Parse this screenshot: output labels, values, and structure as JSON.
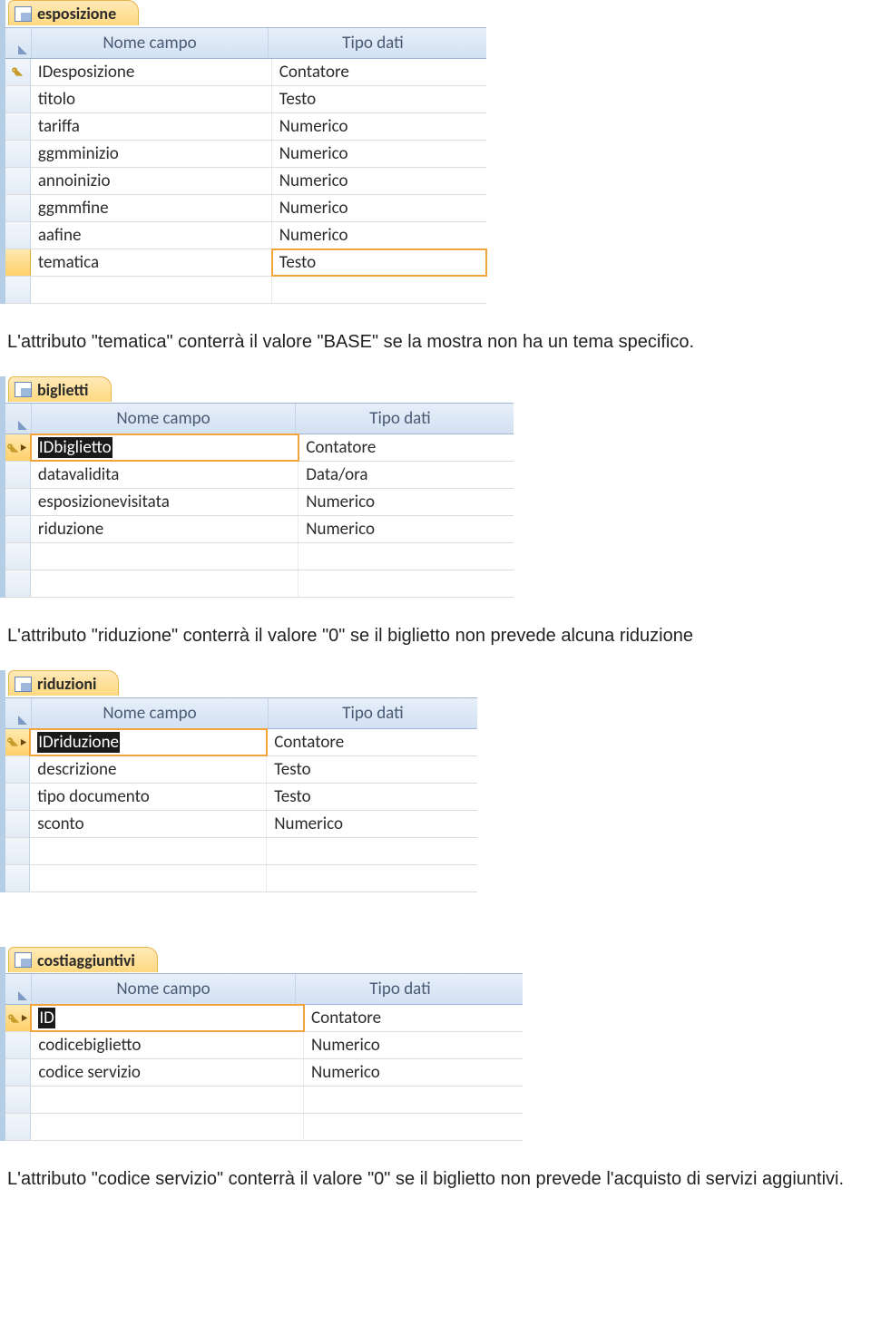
{
  "headers": {
    "nome_campo": "Nome campo",
    "tipo_dati": "Tipo dati"
  },
  "tables": {
    "esposizione": {
      "tab_label": "esposizione",
      "rows": [
        {
          "name": "IDesposizione",
          "type": "Contatore",
          "pk": true
        },
        {
          "name": "titolo",
          "type": "Testo"
        },
        {
          "name": "tariffa",
          "type": "Numerico"
        },
        {
          "name": "ggmminizio",
          "type": "Numerico"
        },
        {
          "name": "annoinizio",
          "type": "Numerico"
        },
        {
          "name": "ggmmfine",
          "type": "Numerico"
        },
        {
          "name": "aafine",
          "type": "Numerico"
        },
        {
          "name": "tematica",
          "type": "Testo"
        }
      ]
    },
    "biglietti": {
      "tab_label": "biglietti",
      "rows": [
        {
          "name": "IDbiglietto",
          "type": "Contatore",
          "pk": true,
          "selected": true
        },
        {
          "name": "datavalidita",
          "type": "Data/ora"
        },
        {
          "name": "esposizionevisitata",
          "type": "Numerico"
        },
        {
          "name": "riduzione",
          "type": "Numerico"
        }
      ]
    },
    "riduzioni": {
      "tab_label": "riduzioni",
      "rows": [
        {
          "name": "IDriduzione",
          "type": "Contatore",
          "pk": true,
          "selected": true
        },
        {
          "name": "descrizione",
          "type": "Testo"
        },
        {
          "name": "tipo documento",
          "type": "Testo"
        },
        {
          "name": "sconto",
          "type": "Numerico"
        }
      ]
    },
    "costiaggiuntivi": {
      "tab_label": "costiaggiuntivi",
      "rows": [
        {
          "name": "ID",
          "type": "Contatore",
          "pk": true,
          "selected": true
        },
        {
          "name": "codicebiglietto",
          "type": "Numerico"
        },
        {
          "name": "codice servizio",
          "type": "Numerico"
        }
      ]
    }
  },
  "paragraphs": {
    "p1": "L'attributo \"tematica\" conterrà il valore \"BASE\" se la mostra non ha un tema specifico.",
    "p2": "L'attributo \"riduzione\" conterrà il valore \"0\" se il biglietto non prevede alcuna riduzione",
    "p3": "L'attributo \"codice servizio\" conterrà il valore \"0\" se il biglietto non prevede l'acquisto di servizi aggiuntivi."
  }
}
